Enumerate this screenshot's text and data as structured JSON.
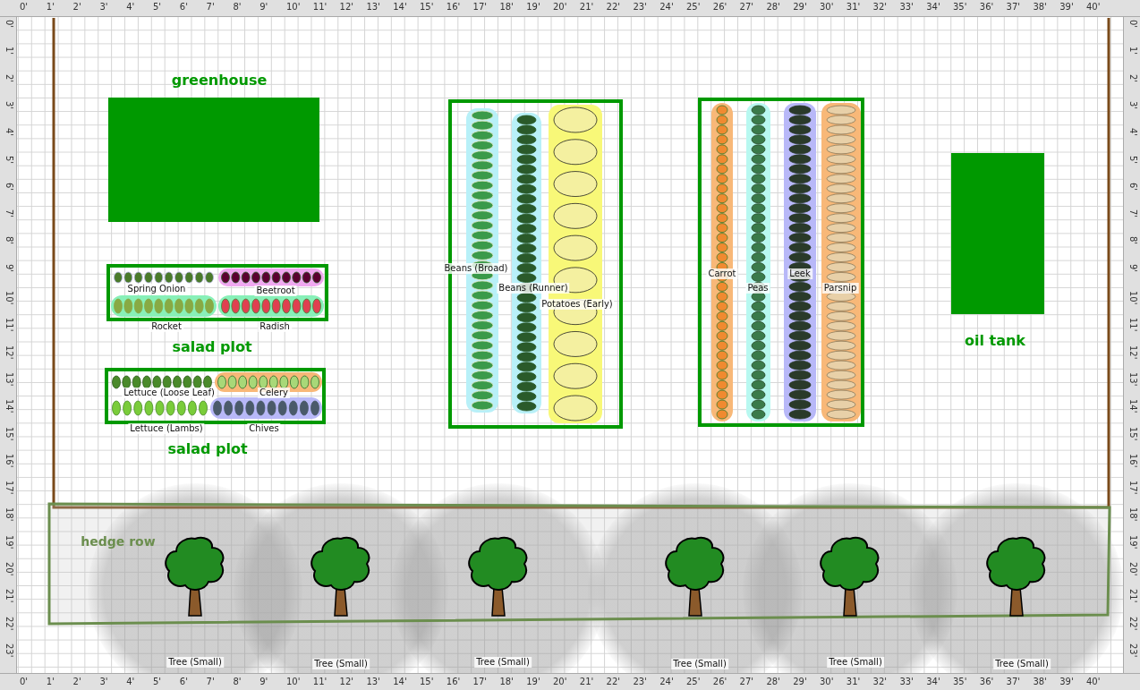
{
  "rulers": {
    "top": [
      "0'",
      "1'",
      "2'",
      "3'",
      "4'",
      "5'",
      "6'",
      "7'",
      "8'",
      "9'",
      "10'",
      "11'",
      "12'",
      "13'",
      "14'",
      "15'",
      "16'",
      "17'",
      "18'",
      "19'",
      "20'",
      "21'",
      "22'",
      "23'",
      "24'",
      "25'",
      "26'",
      "27'",
      "28'",
      "29'",
      "30'",
      "31'",
      "32'",
      "33'",
      "34'",
      "35'",
      "36'",
      "37'",
      "38'",
      "39'",
      "40'"
    ],
    "bottom": [
      "0'",
      "1'",
      "2'",
      "3'",
      "4'",
      "5'",
      "6'",
      "7'",
      "8'",
      "9'",
      "10'",
      "11'",
      "12'",
      "13'",
      "14'",
      "15'",
      "16'",
      "17'",
      "18'",
      "19'",
      "20'",
      "21'",
      "22'",
      "23'",
      "24'",
      "25'",
      "26'",
      "27'",
      "28'",
      "29'",
      "30'",
      "31'",
      "32'",
      "33'",
      "34'",
      "35'",
      "36'",
      "37'",
      "38'",
      "39'",
      "40'"
    ],
    "left": [
      "0'",
      "1'",
      "2'",
      "3'",
      "4'",
      "5'",
      "6'",
      "7'",
      "8'",
      "9'",
      "10'",
      "11'",
      "12'",
      "13'",
      "14'",
      "15'",
      "16'",
      "17'",
      "18'",
      "19'",
      "20'",
      "21'",
      "22'",
      "23'"
    ],
    "right": [
      "0'",
      "1'",
      "2'",
      "3'",
      "4'",
      "5'",
      "6'",
      "7'",
      "8'",
      "9'",
      "10'",
      "11'",
      "12'",
      "13'",
      "14'",
      "15'",
      "16'",
      "17'",
      "18'",
      "19'",
      "20'",
      "21'",
      "22'",
      "23'"
    ]
  },
  "structures": [
    {
      "label": "greenhouse"
    },
    {
      "label": "oil tank"
    }
  ],
  "beds": [
    {
      "label": "salad plot",
      "kind": "plot",
      "rows": [
        {
          "name": "Spring Onion"
        },
        {
          "name": "Beetroot",
          "color": "#f0a8f0"
        },
        {
          "name": "Rocket",
          "color": "#88f0b8"
        },
        {
          "name": "Radish",
          "color": "#88f0b8"
        }
      ]
    },
    {
      "label": "salad plot",
      "kind": "plot",
      "rows": [
        {
          "name": "Lettuce (Loose Leaf)"
        },
        {
          "name": "Celery",
          "color": "#f8b878"
        },
        {
          "name": "Lettuce (Lambs)"
        },
        {
          "name": "Chives",
          "color": "#b8b8f8"
        }
      ]
    },
    {
      "kind": "bed",
      "rows": [
        {
          "name": "Beans (Broad)",
          "color": "#b8f0f8"
        },
        {
          "name": "Beans (Runner)",
          "color": "#b8f0f8"
        },
        {
          "name": "Potatoes (Early)",
          "color": "#f8f878"
        }
      ]
    },
    {
      "kind": "bed",
      "rows": [
        {
          "name": "Carrot",
          "color": "#f8b878"
        },
        {
          "name": "Peas",
          "color": "#b8f8f0"
        },
        {
          "name": "Leek",
          "color": "#b8b8f8"
        },
        {
          "name": "Parsnip",
          "color": "#f8b878"
        }
      ]
    }
  ],
  "hedge": {
    "label": "hedge row"
  },
  "trees": [
    {
      "name": "Tree (Small)"
    },
    {
      "name": "Tree (Small)"
    },
    {
      "name": "Tree (Small)"
    },
    {
      "name": "Tree (Small)"
    },
    {
      "name": "Tree (Small)"
    },
    {
      "name": "Tree (Small)"
    }
  ]
}
